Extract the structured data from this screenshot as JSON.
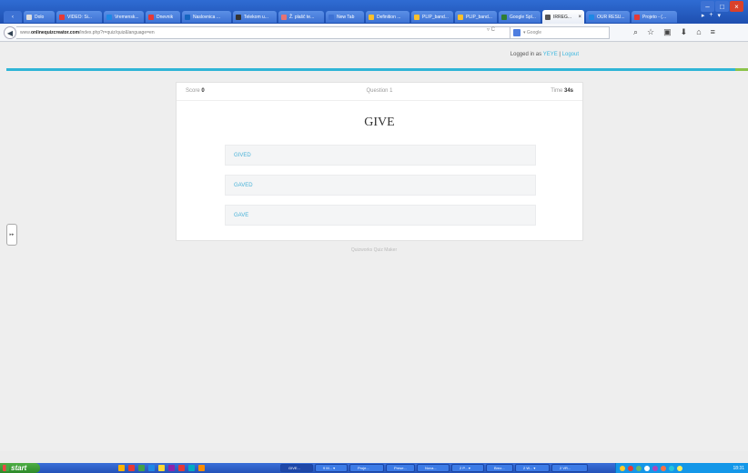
{
  "browser": {
    "tabs": [
      {
        "label": "Dolo",
        "fav": "#ddd"
      },
      {
        "label": "VIDEO: Si...",
        "fav": "#e53935"
      },
      {
        "label": "Vremensk...",
        "fav": "#1e88e5"
      },
      {
        "label": "Dnevnik",
        "fav": "#e53935"
      },
      {
        "label": "Naslovnica ...",
        "fav": "#1565c0"
      },
      {
        "label": "Telekom u...",
        "fav": "#333"
      },
      {
        "label": "Ž. plašč te...",
        "fav": "#e57373"
      },
      {
        "label": "New Tab",
        "fav": "#3d72d4"
      },
      {
        "label": "Definition ...",
        "fav": "#fbc02d"
      },
      {
        "label": "PLIP_band...",
        "fav": "#fbc02d"
      },
      {
        "label": "PLIP_band...",
        "fav": "#fbc02d"
      },
      {
        "label": "Google Spl...",
        "fav": "#2e7d32"
      },
      {
        "label": "IRREG...",
        "fav": "#555",
        "active": true,
        "close": "×"
      },
      {
        "label": "OUR RESU...",
        "fav": "#1e88e5"
      },
      {
        "label": "Projeto - (...",
        "fav": "#e53935"
      }
    ],
    "tab_controls": {
      "more": "▸",
      "new_tab": "+",
      "list": "▾"
    },
    "window_buttons": {
      "minimize": "–",
      "maximize": "□",
      "close": "×"
    },
    "back": "◀",
    "url_prefix": "www.",
    "url_domain": "onlinequizcreator.com",
    "url_path": "/index.php?r=quiz/quiz&language=en",
    "url_controls": "▿ C",
    "search_placeholder": "▾ Google",
    "nav_icons": [
      "⌕",
      "☆",
      "▣",
      "⬇",
      "⌂",
      "≡"
    ]
  },
  "page": {
    "logged_in_prefix": "Logged in as",
    "username": "YEYE",
    "separator": "|",
    "logout": "Logout",
    "accent_color": "#2fb5d7",
    "side_tab": "▸▸"
  },
  "quiz": {
    "score_label": "Score",
    "score_value": "0",
    "question_label": "Question 1",
    "time_label": "Time",
    "time_value": "34s",
    "question": "GIVE",
    "answers": [
      "GIVED",
      "GAVED",
      "GAVE"
    ],
    "footer": "Quizworks Quiz Maker"
  },
  "taskbar": {
    "start": "start",
    "tasks": [
      {
        "label": "GIVE..."
      },
      {
        "label": "9 M... ▾"
      },
      {
        "label": "Proje..."
      },
      {
        "label": "Prese..."
      },
      {
        "label": "Nova..."
      },
      {
        "label": "2 P... ▾"
      },
      {
        "label": "Brez..."
      },
      {
        "label": "2 W... ▾"
      },
      {
        "label": "2 VR..."
      }
    ],
    "clock": "18:31"
  }
}
